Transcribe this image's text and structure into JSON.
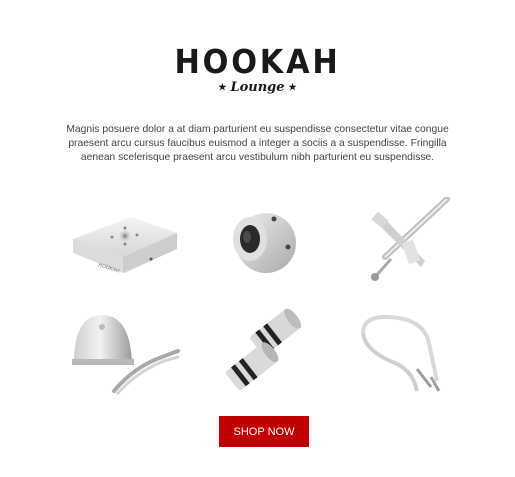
{
  "logo": {
    "main": "HOOKAH",
    "sub": "Lounge",
    "stars": "★"
  },
  "intro_text": "Magnis posuere dolor a at diam parturient eu suspendisse consectetur vitae congue praesent arcu cursus faucibus euismod a integer a sociis a a suspendisse. Fringilla aenean scelerisque praesent arcu vestibulum nibh parturient eu suspendisse.",
  "products": [
    {
      "name": "square hookah base",
      "label": "HOOKAH"
    },
    {
      "name": "metal connector ring"
    },
    {
      "name": "hookah stem with purge valve"
    },
    {
      "name": "bowl with tongs"
    },
    {
      "name": "hose adapters"
    },
    {
      "name": "hookah hose"
    }
  ],
  "cta": {
    "label": "SHOP NOW",
    "color": "#c00000"
  }
}
